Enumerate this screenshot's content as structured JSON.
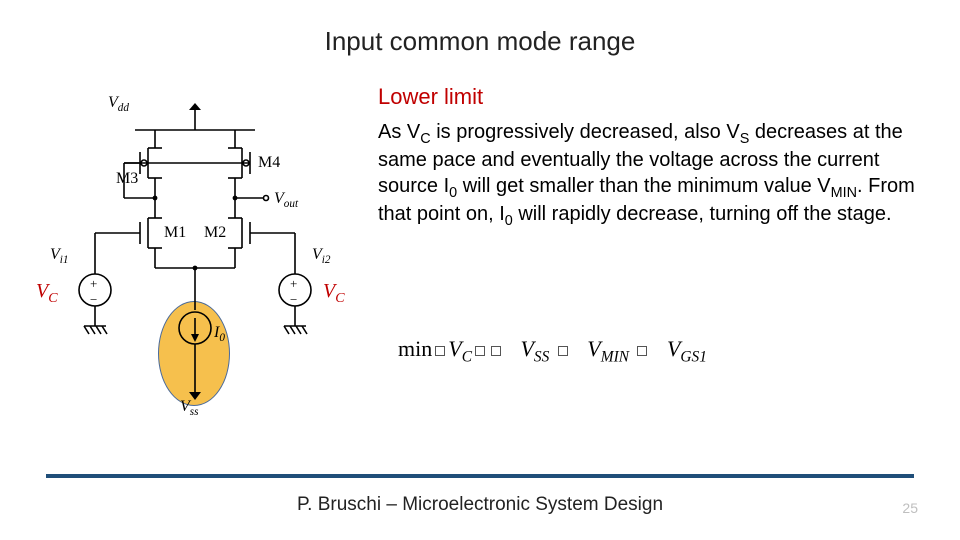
{
  "title": "Input common mode range",
  "subtitle": "Lower limit",
  "paragraph_html": "As V<sub>C</sub> is progressively decreased, also V<sub>S</sub> decreases at the same pace and eventually the voltage across the current source I<sub>0</sub> will get smaller than the minimum value V<sub>MIN</sub>. From that point on, I<sub>0</sub> will rapidly decrease, turning off the stage.",
  "equation": {
    "prefix": "min",
    "terms": [
      "V",
      "V",
      "V",
      "V"
    ],
    "subs": [
      "C",
      "SS",
      "MIN",
      "GS1"
    ]
  },
  "diagram": {
    "vdd": "V",
    "vdd_sub": "dd",
    "m1": "M1",
    "m2": "M2",
    "m3": "M3",
    "m4": "M4",
    "vout": "V",
    "vout_sub": "out",
    "vi1": "V",
    "vi1_sub": "i1",
    "vi2": "V",
    "vi2_sub": "i2",
    "i0": "I",
    "i0_sub": "0",
    "vss": "V",
    "vss_sub": "ss",
    "vc": "V",
    "vc_sub": "C",
    "plus": "+",
    "minus": "−"
  },
  "footer": "P. Bruschi – Microelectronic System Design",
  "page_number": "25"
}
